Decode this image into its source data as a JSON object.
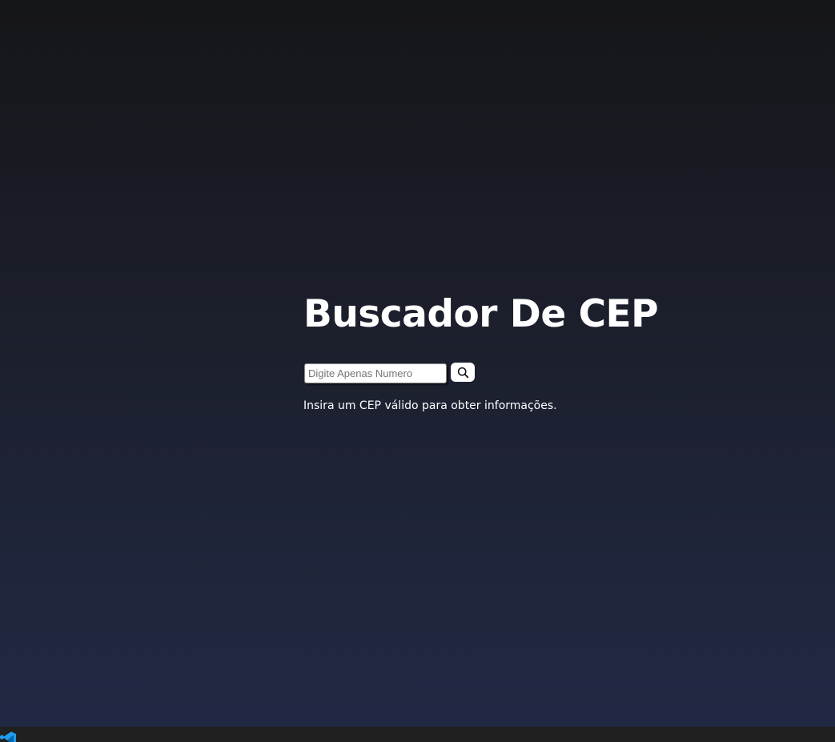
{
  "header": {
    "title": "Buscador De CEP"
  },
  "search": {
    "placeholder": "Digite Apenas Numero",
    "value": "",
    "button_icon": "search-icon"
  },
  "status": {
    "message": "Insira um CEP válido para obter informações."
  },
  "taskbar": {
    "app_icon": "vscode-icon"
  },
  "colors": {
    "background_top": "#151619",
    "background_bottom": "#212844",
    "text": "#ffffff",
    "taskbar": "#202020",
    "vscode_blue": "#1f9cf0"
  }
}
